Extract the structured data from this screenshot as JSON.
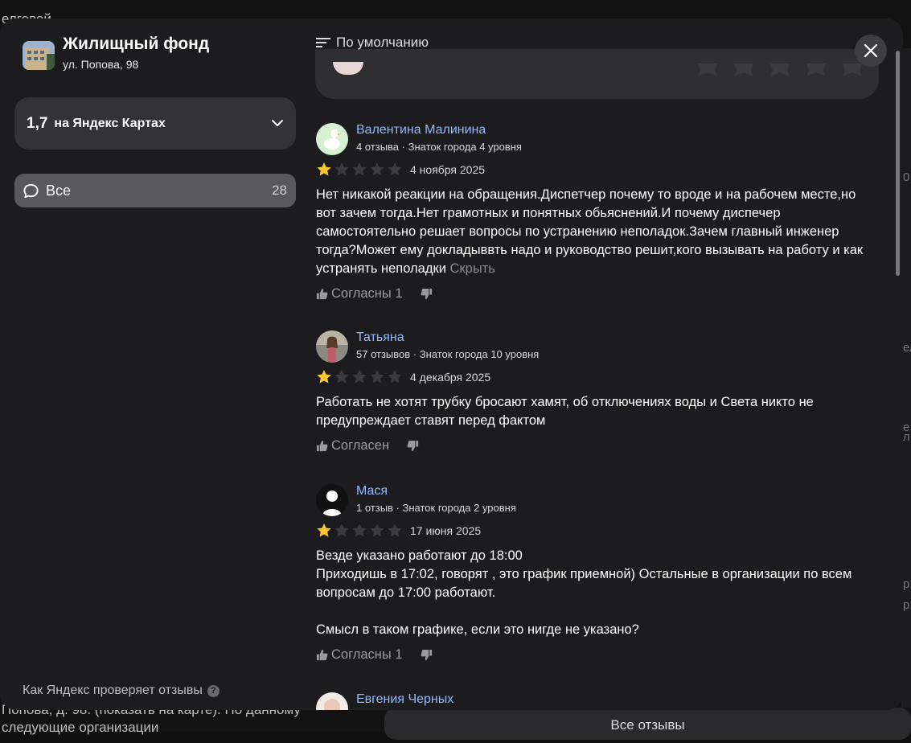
{
  "background": {
    "top_text": "елговой",
    "bottom_text_line1": "Попова, д. 98. (показать на карте). По данному",
    "bottom_text_line2": "следующие организации",
    "all_reviews_button": "Все отзывы",
    "right_glyphs": [
      "0",
      "е",
      "л",
      "ел",
      "р.",
      "р."
    ]
  },
  "organization": {
    "name": "Жилищный фонд",
    "address": "ул. Попова, 98"
  },
  "rating_selector": {
    "value": "1,7",
    "source": "на Яндекс Картах",
    "icon": "chevron-down-icon"
  },
  "filter": {
    "label": "Все",
    "count": "28",
    "icon": "speech-bubble-icon"
  },
  "verify_link": {
    "text": "Как Яндекс проверяет отзывы",
    "icon": "question-icon"
  },
  "sort": {
    "label": "По умолчанию",
    "icon": "sort-lines-icon"
  },
  "close": {
    "icon": "close-icon"
  },
  "colors": {
    "star_filled": "#fcc72c",
    "star_empty": "#3b3b3e",
    "author_link": "#8fb9ff",
    "panel": "#1c1c1e"
  },
  "reviews": [
    {
      "author": "Валентина Малинина",
      "meta": "4 отзыва · Знаток города 4 уровня",
      "rating": 1,
      "date": "4 ноября 2025",
      "text": "Нет никакой реакции на обращения.Диспетчер почему то вроде и на рабочем месте,но вот зачем тогда.Нет грамотных и понятных обьяснений.И почему диспечер самостоятельно решает вопросы по устранению неполадок.Зачем главный инженер тогда?Может ему докладыввть надо и руководство решит,кого вызывать на работу и как устранять неполадки",
      "hide_label": "Скрыть",
      "like_label": "Согласны 1"
    },
    {
      "author": "Татьяна",
      "meta": "57 отзывов · Знаток города 10 уровня",
      "rating": 1,
      "date": "4 декабря 2025",
      "text": "Работать не хотят трубку бросают хамят, об отключениях воды и Света никто не предупреждает ставят перед фактом",
      "like_label": "Согласен"
    },
    {
      "author": "Мася",
      "meta": "1 отзыв · Знаток города 2 уровня",
      "rating": 1,
      "date": "17 июня 2025",
      "text": "Везде указано работают до 18:00\nПриходишь в 17:02, говорят , это график приемной) Остальные в организации по всем вопросам до 17:00 работают.\n\nСмысл в таком графике, если это нигде не указано?",
      "like_label": "Согласны 1"
    },
    {
      "author": "Евгения Черных"
    }
  ]
}
